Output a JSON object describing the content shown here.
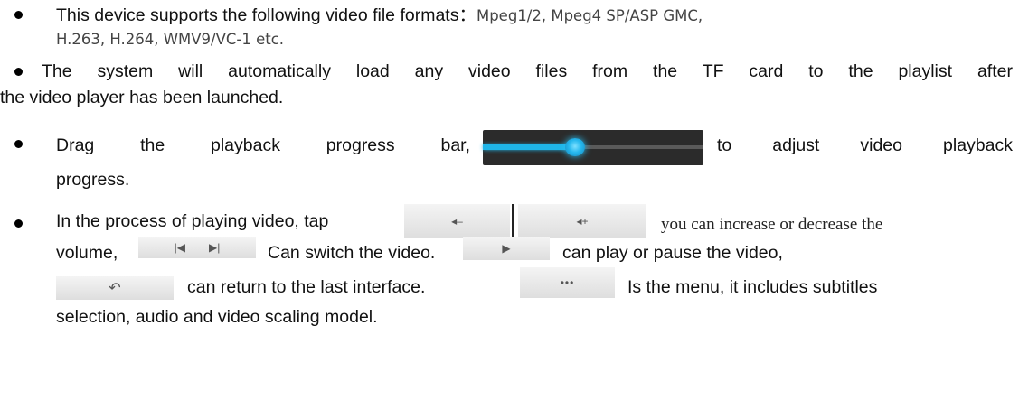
{
  "bullets": [
    {
      "line1_main": "This device supports the following video file formats：",
      "line1_formats": "Mpeg1/2, Mpeg4 SP/ASP GMC,",
      "line2_formats": "H.263, H.264, WMV9/VC-1 etc."
    },
    {
      "line1": "The system will automatically load any video files from the TF card to the playlist after",
      "line2": "the video player has been launched."
    },
    {
      "line1_start": "Drag the playback progress bar,",
      "line1_end": "to adjust video playback",
      "line2": "progress.",
      "progress_fraction": 0.42
    },
    {
      "line1_start": "In the process of playing video, tap",
      "line1_end": "you can increase or decrease the",
      "line2_a": "volume,",
      "line2_b": "Can switch the video.",
      "line2_c": "can play or pause the video,",
      "line3_a": "can return to the last interface.",
      "line3_b": "Is the menu, it includes subtitles",
      "line4": "selection, audio and video scaling model."
    }
  ],
  "icons": {
    "volume_down": "volume-down-icon",
    "volume_up": "volume-up-icon",
    "prev": "previous-icon",
    "next": "next-icon",
    "play": "play-icon",
    "back": "back-icon",
    "menu": "menu-icon"
  },
  "colors": {
    "progress_accent": "#1fb5e8",
    "progress_bg": "#2b2b2b",
    "tile_bg": "#e6e6e6"
  }
}
